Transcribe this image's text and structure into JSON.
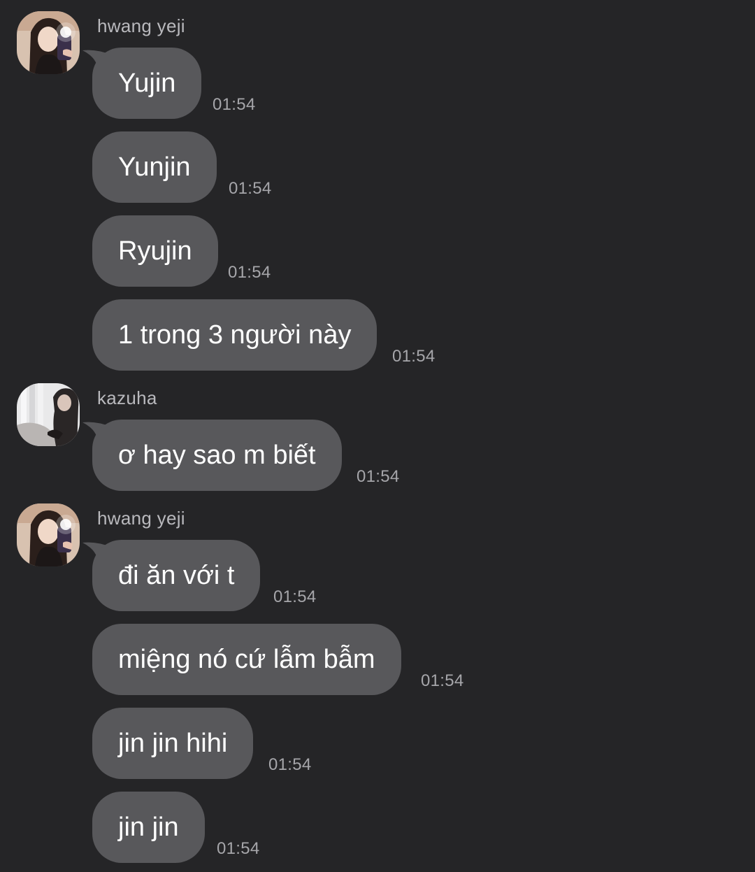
{
  "groups": [
    {
      "sender": "hwang yeji",
      "avatar_icon": "profile-photo-girl-mirror-selfie",
      "messages": [
        {
          "text": "Yujin",
          "time": "01:54"
        },
        {
          "text": "Yunjin",
          "time": "01:54"
        },
        {
          "text": "Ryujin",
          "time": "01:54"
        },
        {
          "text": "1 trong 3 người này",
          "time": "01:54"
        }
      ]
    },
    {
      "sender": "kazuha",
      "avatar_icon": "profile-photo-bright-room",
      "messages": [
        {
          "text": "ơ hay sao m biết",
          "time": "01:54"
        }
      ]
    },
    {
      "sender": "hwang yeji",
      "avatar_icon": "profile-photo-girl-mirror-selfie",
      "messages": [
        {
          "text": "đi ăn với t",
          "time": "01:54"
        },
        {
          "text": "miệng nó cứ lẫm bẫm",
          "time": "01:54"
        },
        {
          "text": "jin jin hihi",
          "time": "01:54"
        },
        {
          "text": "jin jin",
          "time": "01:54"
        }
      ]
    }
  ],
  "colors": {
    "background": "#252527",
    "bubble": "#58585b",
    "sender_name": "#b9b9bd",
    "timestamp": "#a6a6aa",
    "message_text": "#ffffff"
  }
}
